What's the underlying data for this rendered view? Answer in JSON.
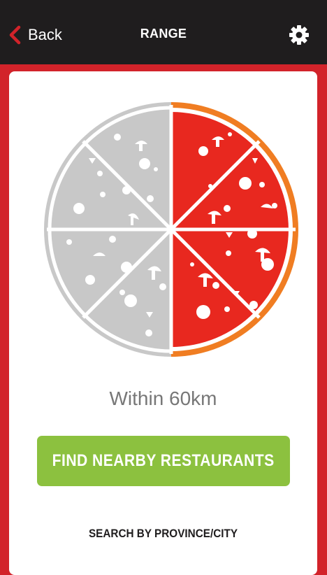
{
  "header": {
    "back_label": "Back",
    "title": "RANGE"
  },
  "range": {
    "text": "Within 60km",
    "slices_total": 8,
    "slices_selected": 4
  },
  "actions": {
    "find_label": "FIND NEARBY RESTAURANTS",
    "search_label": "SEARCH BY PROVINCE/CITY"
  },
  "colors": {
    "topbar": "#1f1d1e",
    "frame": "#d2232a",
    "accent_red": "#e8281f",
    "crust_orange": "#f07d22",
    "inactive_gray": "#c8c8c8",
    "button_green": "#8cc13f"
  },
  "icons": {
    "back": "chevron-left-icon",
    "settings": "gear-icon"
  }
}
